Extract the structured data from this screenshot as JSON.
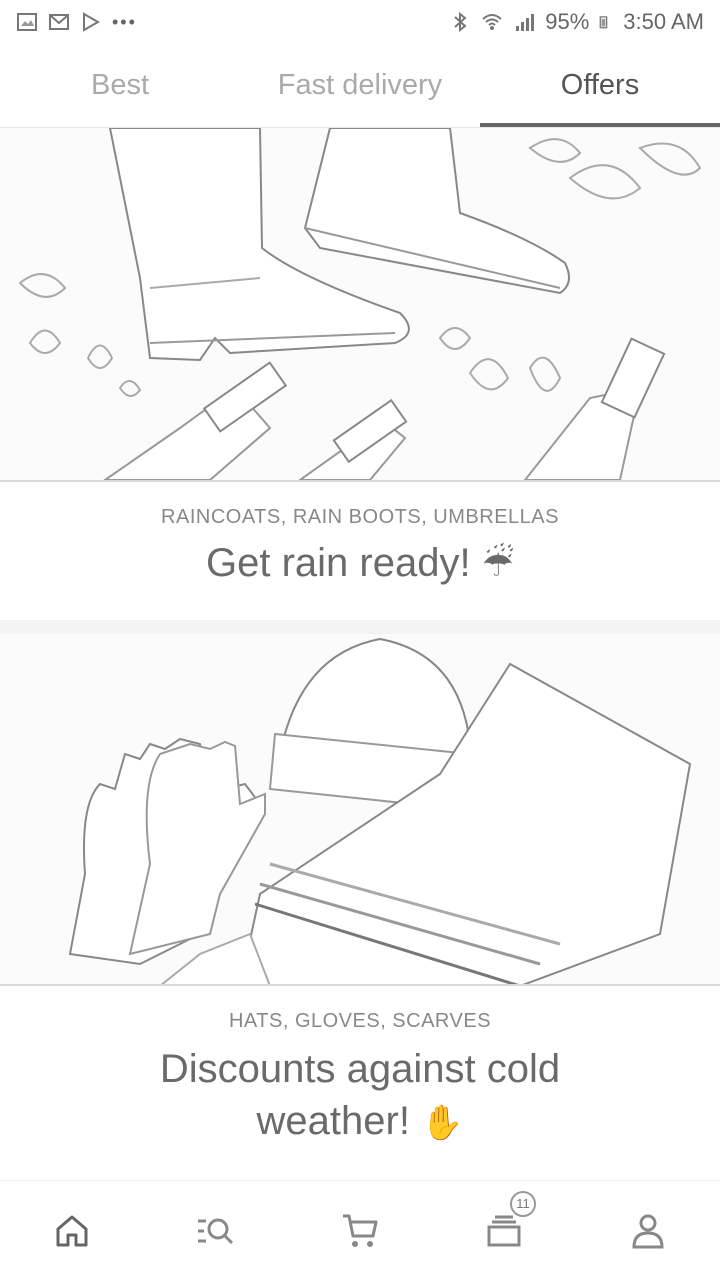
{
  "status_bar": {
    "battery": "95%",
    "time": "3:50 AM",
    "overflow": "•••"
  },
  "tabs": [
    {
      "label": "Best",
      "active": false
    },
    {
      "label": "Fast delivery",
      "active": false
    },
    {
      "label": "Offers",
      "active": true
    }
  ],
  "offers": [
    {
      "subtitle": "RAINCOATS, RAIN BOOTS, UMBRELLAS",
      "title": "Get rain ready!",
      "emoji": "☔"
    },
    {
      "subtitle": "HATS, GLOVES, SCARVES",
      "title_line1": "Discounts against cold",
      "title_line2": "weather!",
      "emoji": "✋"
    }
  ],
  "bottom_nav": {
    "items": [
      {
        "icon": "home-icon"
      },
      {
        "icon": "search-list-icon"
      },
      {
        "icon": "cart-icon"
      },
      {
        "icon": "orders-icon",
        "badge": "11"
      },
      {
        "icon": "profile-icon"
      }
    ]
  }
}
